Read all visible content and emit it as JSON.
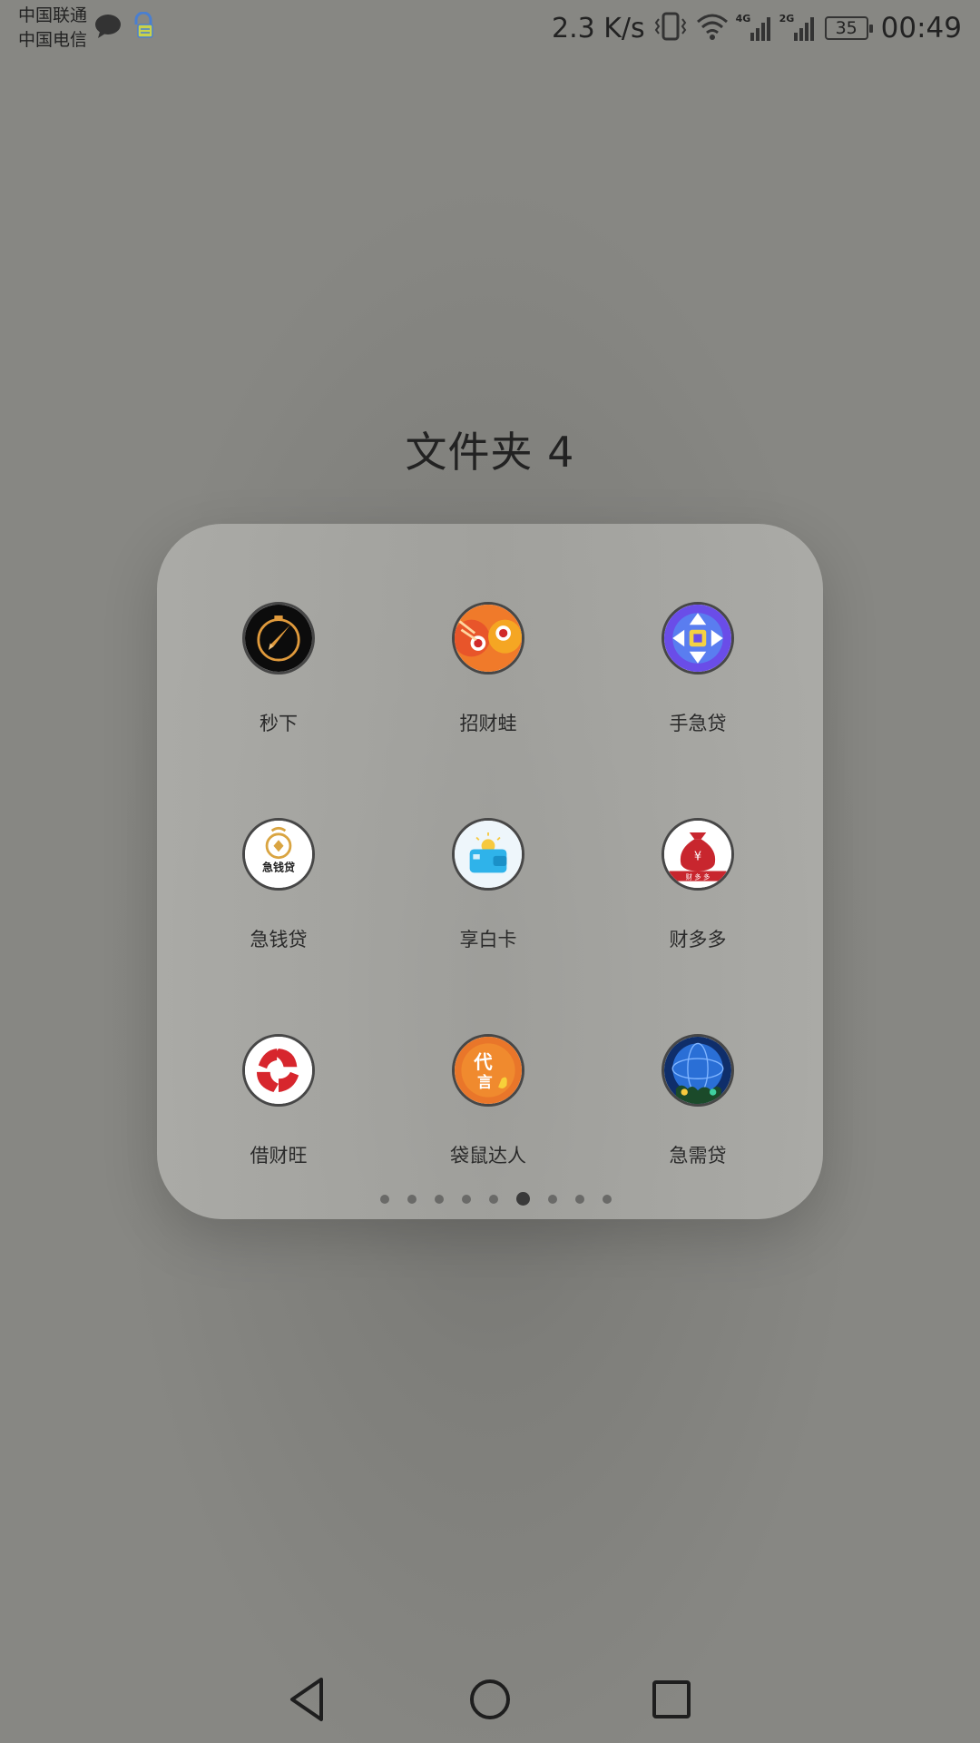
{
  "status_bar": {
    "carrier_1": "中国联通",
    "carrier_2": "中国电信",
    "net_speed": "2.3 K/s",
    "signal_1_type": "4G",
    "signal_2_type": "2G",
    "battery": "35",
    "time": "00:49"
  },
  "folder": {
    "title": "文件夹 4",
    "apps": [
      {
        "label": "秒下",
        "icon": "rocket-compass-icon"
      },
      {
        "label": "招财蛙",
        "icon": "lucky-frog-icon"
      },
      {
        "label": "手急贷",
        "icon": "purple-coin-arrows-icon"
      },
      {
        "label": "急钱贷",
        "icon": "gold-coin-bag-icon"
      },
      {
        "label": "享白卡",
        "icon": "blue-wallet-icon"
      },
      {
        "label": "财多多",
        "icon": "red-money-bag-icon"
      },
      {
        "label": "借财旺",
        "icon": "red-swirl-icon"
      },
      {
        "label": "袋鼠达人",
        "icon": "orange-kangaroo-icon"
      },
      {
        "label": "急需贷",
        "icon": "blue-globe-icon"
      }
    ],
    "page_count": 9,
    "active_page": 6
  },
  "nav_bar": {
    "back": "back-icon",
    "home": "home-icon",
    "recents": "recents-icon"
  },
  "colors": {
    "background": "#7e7e7a",
    "panel": "#b0b0ac",
    "text": "#222222"
  }
}
